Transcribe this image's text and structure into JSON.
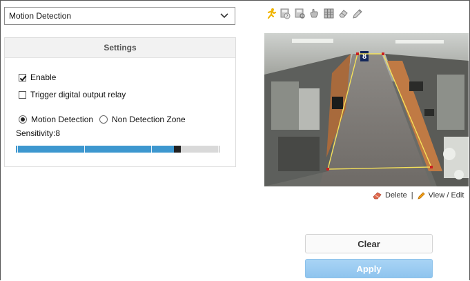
{
  "mode_select": {
    "value": "Motion Detection"
  },
  "settings": {
    "title": "Settings",
    "enable": {
      "label": "Enable",
      "checked": true
    },
    "trigger": {
      "label": "Trigger digital output relay",
      "checked": false
    },
    "radio_motion": {
      "label": "Motion Detection",
      "selected": true
    },
    "radio_non": {
      "label": "Non Detection Zone",
      "selected": false
    },
    "sensitivity_label": "Sensitivity:8",
    "sensitivity": {
      "value": 8,
      "max": 10
    }
  },
  "toolbar": {
    "icons": [
      "running-man-icon",
      "disk-help-icon",
      "disk-view-icon",
      "hand-icon",
      "grid-icon",
      "eraser-icon",
      "pencil-icon"
    ]
  },
  "camera": {
    "zone_number": "8",
    "zone_color": "#f5e15a",
    "corner_color": "#cc1f1f"
  },
  "actions": {
    "delete_label": "Delete",
    "separator": "|",
    "view_edit_label": "View / Edit"
  },
  "buttons": {
    "clear_label": "Clear",
    "apply_label": "Apply"
  }
}
